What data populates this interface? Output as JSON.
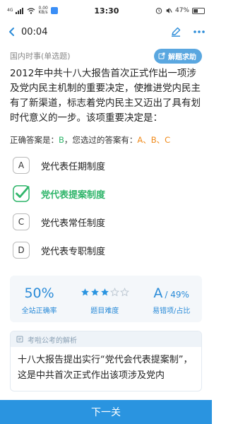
{
  "status_bar": {
    "network": "4G",
    "speed": "0.00\nKB/s",
    "time": "13:30",
    "battery": "47%"
  },
  "header": {
    "timer": "00:04"
  },
  "question": {
    "type": "国内时事(单选题)",
    "help_label": "解题求助",
    "text": "2012年中共十八大报告首次正式作出一项涉及党内民主机制的重要决定，使推进党内民主有了新渠道，标志着党内民主又迈出了具有划时代意义的一步。该项重要决定是："
  },
  "answer": {
    "correct_prefix": "正确答案是：",
    "correct": "B",
    "selected_prefix": "，您选过的答案有：",
    "selected": "A、B、C"
  },
  "options": [
    {
      "letter": "A",
      "text": "党代表任期制度",
      "correct": false
    },
    {
      "letter": "B",
      "text": "党代表提案制度",
      "correct": true
    },
    {
      "letter": "C",
      "text": "党代表常任制度",
      "correct": false
    },
    {
      "letter": "D",
      "text": "党代表专职制度",
      "correct": false
    }
  ],
  "stats": {
    "accuracy": "50%",
    "accuracy_label": "全站正确率",
    "difficulty_stars": 3,
    "difficulty_max": 5,
    "difficulty_label": "题目难度",
    "wrong_option": "A",
    "wrong_ratio": "/ 49%",
    "wrong_label": "易错项/占比"
  },
  "analysis": {
    "title": "考啦公考的解析",
    "text": "十八大报告提出实行“党代会代表提案制”，这是中共首次正式作出该项涉及党内"
  },
  "footer": {
    "next_label": "下一关"
  },
  "colors": {
    "accent": "#2a94e0",
    "correct": "#2fb56a",
    "selected": "#f08a1a",
    "help": "#5aa7e0"
  }
}
